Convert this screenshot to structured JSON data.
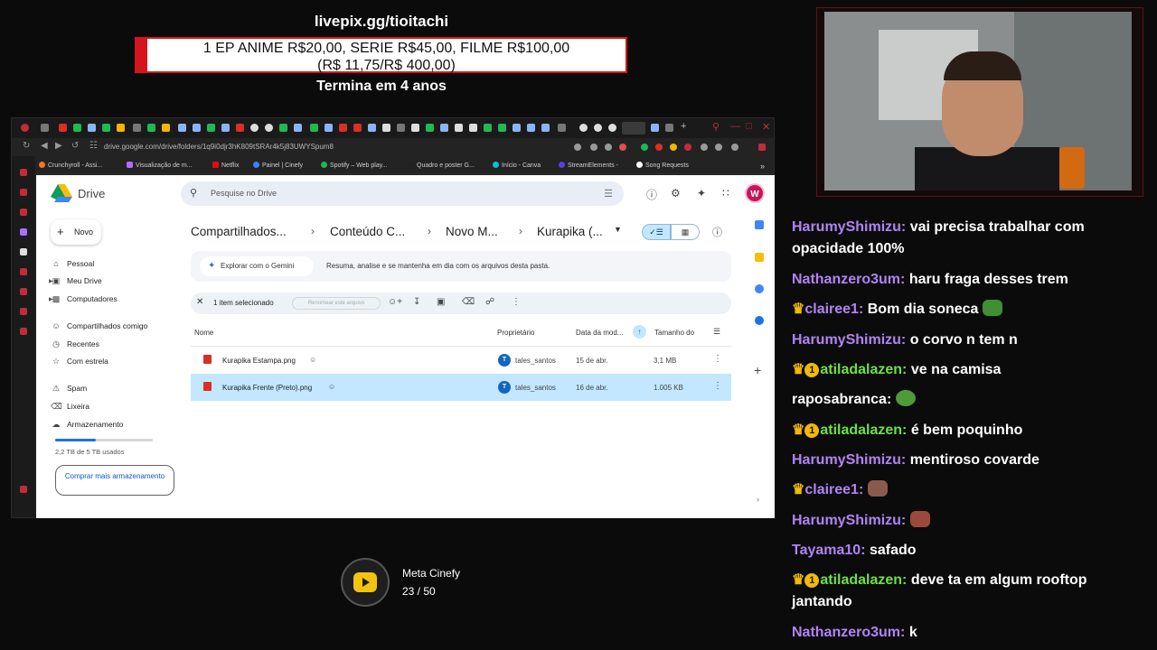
{
  "overlay": {
    "link": "livepix.gg/tioitachi",
    "price_line1": "1 EP ANIME R$20,00, SERIE R$45,00, FILME R$100,00",
    "price_line2": "(R$ 11,75/R$ 400,00)",
    "ends": "Termina em 4 anos"
  },
  "browser": {
    "url": "drive.google.com/drive/folders/1q9i0djr3hK809tSRAr4k5j83UWYSpum8",
    "bookmarks": [
      {
        "label": "Crunchyroll - Assi...",
        "color": "#f47521"
      },
      {
        "label": "Visualização de m...",
        "color": "#a970ff"
      },
      {
        "label": "Netflix",
        "color": "#e50914"
      },
      {
        "label": "Painel | Cinefy",
        "color": "#3b82f6"
      },
      {
        "label": "Spotify – Web play...",
        "color": "#1db954"
      },
      {
        "label": "Quadro e poster G...",
        "color": "#222222"
      },
      {
        "label": "Início - Canva",
        "color": "#00c4cc"
      },
      {
        "label": "StreamElements -",
        "color": "#5a3fd6"
      },
      {
        "label": "Song Requests",
        "color": "#ffffff"
      }
    ]
  },
  "drive": {
    "app_name": "Drive",
    "search_placeholder": "Pesquise no Drive",
    "avatar_letter": "W",
    "new_label": "Novo",
    "nav": {
      "pessoal": "Pessoal",
      "meu_drive": "Meu Drive",
      "computadores": "Computadores",
      "compartilhados": "Compartilhados comigo",
      "recentes": "Recentes",
      "com_estrela": "Com estrela",
      "spam": "Spam",
      "lixeira": "Lixeira",
      "armazenamento": "Armazenamento"
    },
    "storage_used_fraction": 0.42,
    "storage_text": "2,2 TB de 5 TB usados",
    "buy_storage": "Comprar mais armazenamento",
    "breadcrumb": [
      "Compartilhados...",
      "Conteúdo C...",
      "Novo M...",
      "Kurapika (..."
    ],
    "gemini_button": "Explorar com o Gemini",
    "gemini_text": "Resuma, analise e se mantenha em dia com os arquivos desta pasta.",
    "selection_count": "1 item selecionado",
    "rename_placeholder": "Renomear este arquivo",
    "columns": {
      "name": "Nome",
      "owner": "Proprietário",
      "modified": "Data da mod...",
      "size": "Tamanho do"
    },
    "files": [
      {
        "name": "Kurapika Estampa.png",
        "owner_initial": "T",
        "owner": "tales_santos",
        "modified": "15 de abr.",
        "size": "3,1 MB"
      },
      {
        "name": "Kurapika Frente (Preto).png",
        "owner_initial": "T",
        "owner": "tales_santos",
        "modified": "16 de abr.",
        "size": "1.005 KB"
      }
    ]
  },
  "meta": {
    "title": "Meta Cinefy",
    "count": "23 / 50"
  },
  "chat": [
    {
      "user": "HarumyShimizu:",
      "color": "#b383f5",
      "text": "vai precisa trabalhar com opacidade 100%"
    },
    {
      "user": "Nathanzero3um:",
      "color": "#b383f5",
      "text": "haru fraga desses trem"
    },
    {
      "user": "clairee1:",
      "color": "#b383f5",
      "text": "Bom dia soneca",
      "crown": true
    },
    {
      "user": "HarumyShimizu:",
      "color": "#b383f5",
      "text": "o corvo n tem n"
    },
    {
      "user": "atiladalazen:",
      "color": "#6ee04a",
      "text": "ve na camisa",
      "crown": true,
      "badge": "1"
    },
    {
      "user": "raposabranca:",
      "color": "#ffffff",
      "text": ""
    },
    {
      "user": "atiladalazen:",
      "color": "#6ee04a",
      "text": "é bem poquinho",
      "crown": true,
      "badge": "1"
    },
    {
      "user": "HarumyShimizu:",
      "color": "#b383f5",
      "text": "mentiroso covarde"
    },
    {
      "user": "clairee1:",
      "color": "#b383f5",
      "text": "",
      "crown": true
    },
    {
      "user": "HarumyShimizu:",
      "color": "#b383f5",
      "text": ""
    },
    {
      "user": "Tayama10:",
      "color": "#b383f5",
      "text": "safado"
    },
    {
      "user": "atiladalazen:",
      "color": "#6ee04a",
      "text": "deve ta em algum rooftop jantando",
      "crown": true,
      "badge": "1"
    },
    {
      "user": "Nathanzero3um:",
      "color": "#b383f5",
      "text": "k"
    }
  ],
  "colors": {
    "accent_red": "#d4151b",
    "drive_selected": "#c2e7ff",
    "chat_purple": "#b383f5",
    "chat_green": "#6ee04a"
  }
}
